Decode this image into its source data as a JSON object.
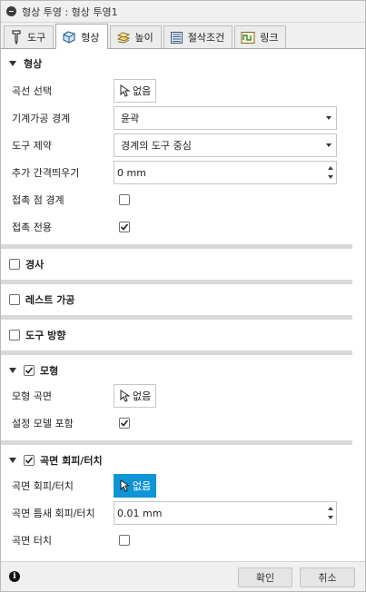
{
  "title": "형상 투영 : 형상 투영1",
  "tabs": [
    {
      "label": "도구",
      "icon": "tool-icon"
    },
    {
      "label": "형상",
      "icon": "shape-icon"
    },
    {
      "label": "높이",
      "icon": "height-icon"
    },
    {
      "label": "절삭조건",
      "icon": "passes-icon"
    },
    {
      "label": "링크",
      "icon": "linking-icon"
    }
  ],
  "active_tab": "형상",
  "geometry": {
    "header": "형상",
    "curve_select_label": "곡선 선택",
    "curve_select_value": "없음",
    "machining_boundary_label": "기계가공 경계",
    "machining_boundary_value": "윤곽",
    "tool_containment_label": "도구 제약",
    "tool_containment_value": "경계의 도구 중심",
    "additional_offset_label": "추가 간격띄우기",
    "additional_offset_value": "0 mm",
    "tangent_boundary_label": "접촉 점 경계",
    "tangent_only_label": "접촉 전용"
  },
  "slope": {
    "header": "경사"
  },
  "rest_machining": {
    "header": "레스트 가공"
  },
  "tool_orientation": {
    "header": "도구 방향"
  },
  "model": {
    "header": "모형",
    "model_surfaces_label": "모형 곡면",
    "model_surfaces_value": "없음",
    "include_setup_model_label": "설정 모델 포함"
  },
  "avoid_touch": {
    "header": "곡면 회피/터치",
    "avoid_touch_label": "곡면 회피/터치",
    "avoid_touch_value": "없음",
    "avoid_gap_label": "곡면 틈새 회피/터치",
    "avoid_gap_value": "0.01 mm",
    "touch_label": "곡면 터치"
  },
  "footer": {
    "ok_label": "확인",
    "cancel_label": "취소"
  }
}
